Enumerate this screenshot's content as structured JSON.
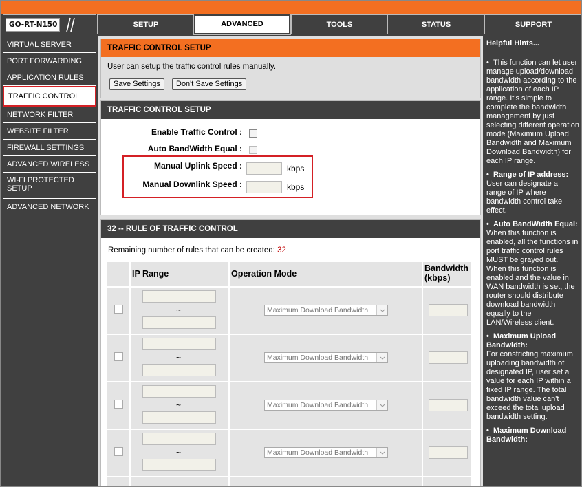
{
  "logo": {
    "text": "GO-RT-N150"
  },
  "tabs": [
    {
      "label": "SETUP",
      "active": false
    },
    {
      "label": "ADVANCED",
      "active": true
    },
    {
      "label": "TOOLS",
      "active": false
    },
    {
      "label": "STATUS",
      "active": false
    },
    {
      "label": "SUPPORT",
      "active": false
    }
  ],
  "sidebar": {
    "items": [
      {
        "label": "VIRTUAL SERVER"
      },
      {
        "label": "PORT FORWARDING"
      },
      {
        "label": "APPLICATION RULES"
      },
      {
        "label": "TRAFFIC CONTROL"
      },
      {
        "label": "NETWORK FILTER"
      },
      {
        "label": "WEBSITE FILTER"
      },
      {
        "label": "FIREWALL SETTINGS"
      },
      {
        "label": "ADVANCED WIRELESS"
      },
      {
        "label": "WI-FI PROTECTED SETUP"
      },
      {
        "label": "ADVANCED NETWORK"
      }
    ]
  },
  "setup_box": {
    "title": "TRAFFIC CONTROL SETUP",
    "description": "User can setup the traffic control rules manually.",
    "save_label": "Save Settings",
    "dont_save_label": "Don't Save Settings"
  },
  "setup_section": {
    "title": "TRAFFIC CONTROL SETUP",
    "enable_label": "Enable Traffic Control :",
    "auto_bw_label": "Auto BandWidth Equal :",
    "uplink_label": "Manual Uplink Speed :",
    "downlink_label": "Manual Downlink Speed :",
    "unit": "kbps"
  },
  "rules_section": {
    "title": "32 -- RULE OF TRAFFIC CONTROL",
    "remaining_text": "Remaining number of rules that can be created: ",
    "remaining_count": "32",
    "columns": {
      "ip_range": "IP Range",
      "operation_mode": "Operation Mode",
      "bandwidth": "Bandwidth (kbps)"
    },
    "tilde": "~",
    "rows": [
      {
        "mode": "Maximum Download Bandwidth"
      },
      {
        "mode": "Maximum Download Bandwidth"
      },
      {
        "mode": "Maximum Download Bandwidth"
      },
      {
        "mode": "Maximum Download Bandwidth"
      }
    ]
  },
  "hints": {
    "title": "Helpful Hints...",
    "items": [
      {
        "heading": "",
        "text": "This function can let user manage upload/download bandwidth according to the application of each IP range. It's simple to complete the bandwidth management by just selecting different operation mode (Maximum Upload Bandwidth and Maximum Download Bandwidth) for each IP range."
      },
      {
        "heading": "Range of IP address:",
        "text": "User can designate a range of IP where bandwidth control take effect."
      },
      {
        "heading": "Auto BandWidth Equal:",
        "text": "When this function is enabled, all the functions in port traffic control rules MUST be grayed out.",
        "text2": "When this function is enabled and the value in WAN bandwidth is set, the router should distribute download bandwidth equally to the LAN/Wireless client."
      },
      {
        "heading": "Maximum Upload Bandwidth:",
        "text": "For constricting maximum uploading bandwidth of designated IP, user set a value for each IP within a fixed IP range. The total bandwidth value can't exceed the total upload bandwidth setting."
      },
      {
        "heading": "Maximum Download Bandwidth:",
        "text": ""
      }
    ]
  }
}
